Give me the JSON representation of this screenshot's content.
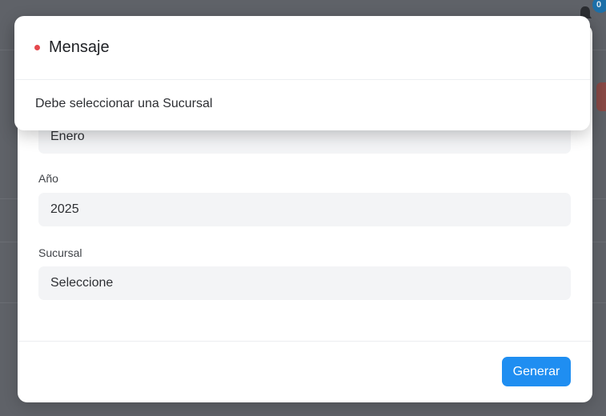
{
  "background": {
    "notification_count": "0"
  },
  "message_dialog": {
    "title": "Mensaje",
    "body": "Debe seleccionar una Sucursal",
    "dot_color": "#e5484d"
  },
  "form": {
    "month_value": "Enero",
    "year_label": "Año",
    "year_value": "2025",
    "branch_label": "Sucursal",
    "branch_value": "Seleccione",
    "generate_label": "Generar",
    "accent_color": "#1f8ef1"
  }
}
